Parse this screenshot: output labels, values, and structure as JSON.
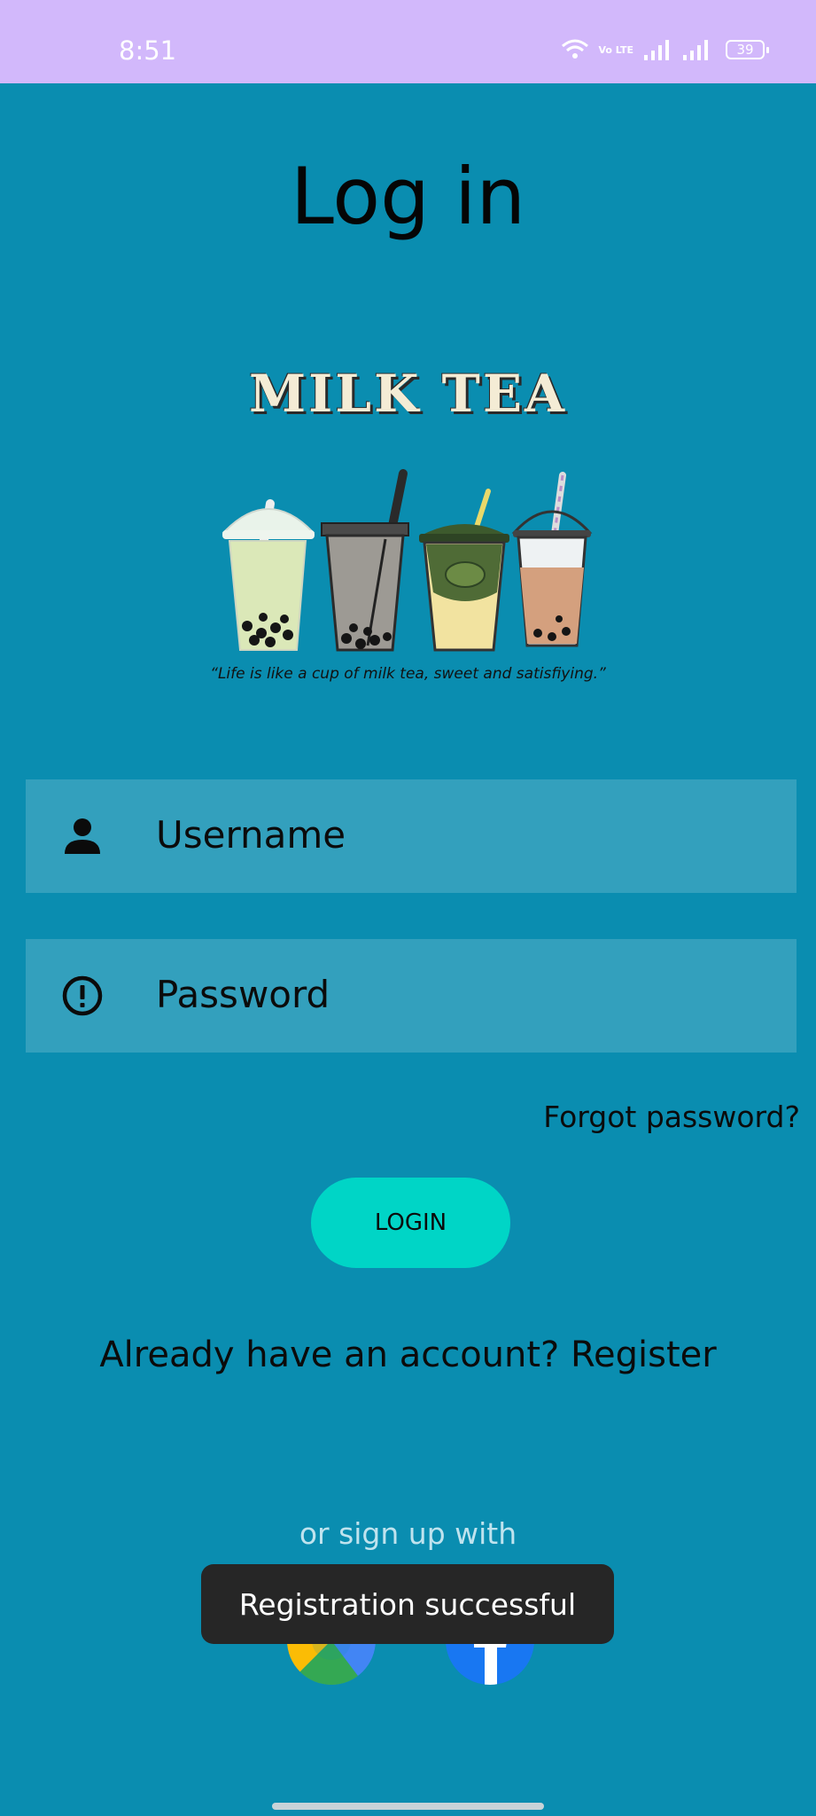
{
  "status_bar": {
    "time": "8:51",
    "volte": "Vo LTE",
    "battery": "39",
    "icons": [
      "wifi-icon",
      "volte-icon",
      "signal-icon",
      "signal-icon",
      "battery-icon"
    ]
  },
  "page": {
    "title": "Log in",
    "brand": "MILK TEA",
    "quote": "“Life is like a cup of milk tea, sweet and satisfiying.”"
  },
  "form": {
    "username_placeholder": "Username",
    "password_placeholder": "Password",
    "forgot_password": "Forgot password?",
    "login_label": "LOGIN",
    "register_text": "Already have an account? Register"
  },
  "social": {
    "label": "or sign up with",
    "providers": [
      "google-icon",
      "facebook-icon"
    ]
  },
  "toast": {
    "message": "Registration successful"
  },
  "colors": {
    "background": "#0a8db0",
    "status_bar": "#d2b8fb",
    "field": "#33a0bd",
    "login_button": "#00d5c6",
    "toast": "#262626"
  }
}
